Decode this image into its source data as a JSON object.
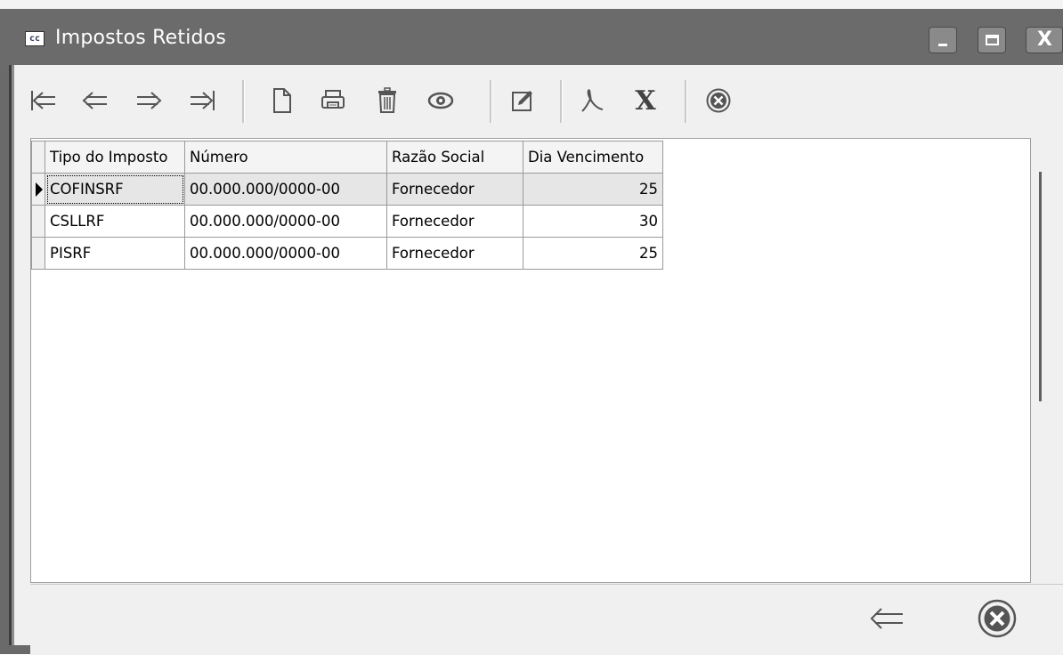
{
  "window": {
    "title": "Impostos Retidos",
    "icon_text": "cc"
  },
  "toolbar": {
    "buttons": [
      {
        "name": "first-record-icon"
      },
      {
        "name": "previous-record-icon"
      },
      {
        "name": "next-record-icon"
      },
      {
        "name": "last-record-icon"
      },
      {
        "name": "new-document-icon"
      },
      {
        "name": "printer-icon"
      },
      {
        "name": "trash-icon"
      },
      {
        "name": "eye-icon"
      },
      {
        "name": "edit-icon"
      },
      {
        "name": "pdf-icon"
      },
      {
        "name": "excel-icon"
      },
      {
        "name": "close-circle-icon"
      }
    ],
    "excel_glyph": "X"
  },
  "grid": {
    "columns": [
      "Tipo do Imposto",
      "Número",
      "Razão Social",
      "Dia Vencimento"
    ],
    "rows": [
      {
        "tipo": "COFINSRF",
        "numero": "00.000.000/0000-00",
        "razao": "Fornecedor",
        "dia": "25"
      },
      {
        "tipo": "CSLLRF",
        "numero": "00.000.000/0000-00",
        "razao": "Fornecedor",
        "dia": "30"
      },
      {
        "tipo": "PISRF",
        "numero": "00.000.000/0000-00",
        "razao": "Fornecedor",
        "dia": "25"
      }
    ],
    "selected_row": 0
  },
  "colors": {
    "titlebar": "#6b6b6b",
    "window_bg": "#f0f0f0",
    "icon_gray": "#555555"
  }
}
